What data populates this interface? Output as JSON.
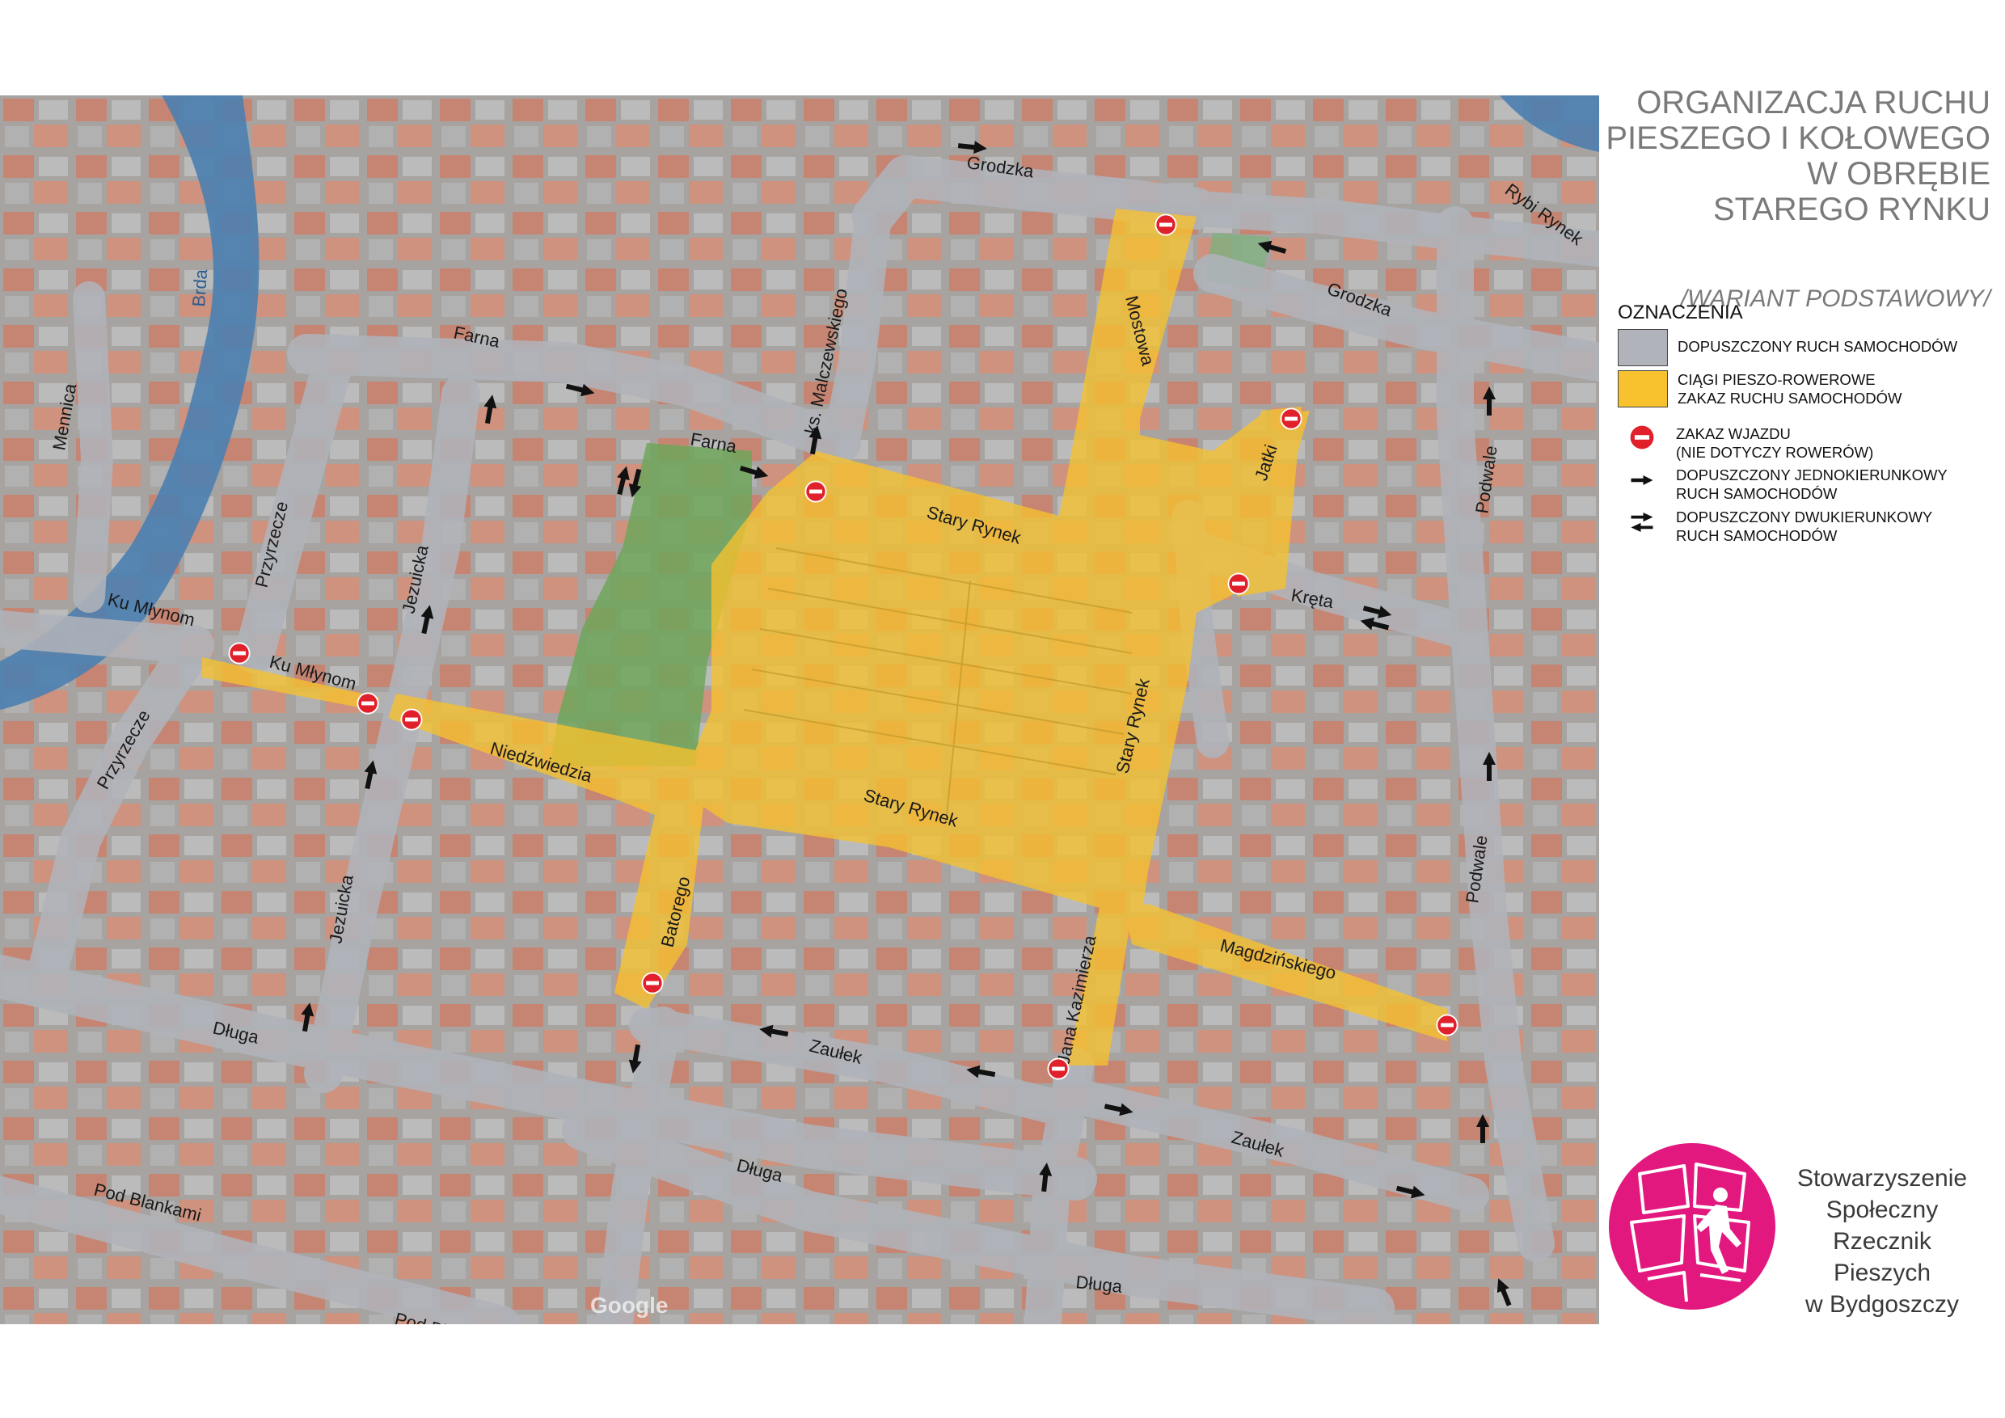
{
  "title_lines": [
    "ORGANIZACJA RUCHU",
    "PIESZEGO I KOŁOWEGO",
    "W OBRĘBIE",
    "STAREGO RYNKU"
  ],
  "subtitle": "/WARIANT PODSTAWOWY/",
  "legend": {
    "heading": "OZNACZENIA",
    "items": [
      {
        "symbol": "grey-swatch",
        "color": "#b0b3ba",
        "lines": [
          "DOPUSZCZONY RUCH SAMOCHODÓW"
        ]
      },
      {
        "symbol": "yellow-swatch",
        "color": "#f7c22e",
        "lines": [
          "CIĄGI PIESZO-ROWEROWE",
          "ZAKAZ RUCHU SAMOCHODÓW"
        ]
      },
      {
        "symbol": "no-entry-icon",
        "lines": [
          "ZAKAZ WJAZDU",
          "(NIE DOTYCZY ROWERÓW)"
        ]
      },
      {
        "symbol": "one-way-arrow-icon",
        "lines": [
          "DOPUSZCZONY JEDNOKIERUNKOWY",
          "RUCH SAMOCHODÓW"
        ]
      },
      {
        "symbol": "two-way-arrow-icon",
        "lines": [
          "DOPUSZCZONY DWUKIERUNKOWY",
          "RUCH SAMOCHODÓW"
        ]
      }
    ]
  },
  "organization": {
    "name_lines": [
      "Stowarzyszenie",
      "Społeczny",
      "Rzecznik Pieszych",
      "w Bydgoszczy"
    ],
    "logo_color": "#e3187f"
  },
  "map": {
    "river_label": "Brda",
    "watermark": "Google",
    "streets": {
      "grodzka_n": "Grodzka",
      "rybi_rynek": "Rybi Rynek",
      "grodzka_e": "Grodzka",
      "mostowa": "Mostowa",
      "malczewskiego": "ks. Malczewskiego",
      "farna_w": "Farna",
      "farna_e": "Farna",
      "mennica": "Mennica",
      "przyrzecze_n": "Przyrzecze",
      "jezuicka_n": "Jezuicka",
      "ku_mlynom_w": "Ku Młynom",
      "ku_mlynom_e": "Ku Młynom",
      "przyrzecze_s": "Przyrzecze",
      "niedzwiedzia": "Niedźwiedzia",
      "stary_rynek_n": "Stary Rynek",
      "jatki": "Jatki",
      "kreta": "Kręta",
      "podwale_n": "Podwale",
      "stary_rynek_e": "Stary Rynek",
      "stary_rynek_s": "Stary Rynek",
      "jezuicka_s": "Jezuicka",
      "batorego": "Batorego",
      "jana_kazimierza": "Jana Kazimierza",
      "magdzinskiego": "Magdzińskiego",
      "podwale_s": "Podwale",
      "dluga_w": "Długa",
      "zaulek_w": "Zaułek",
      "zaulek_e": "Zaułek",
      "dluga_m": "Długa",
      "pod_blankami_w": "Pod Blankami",
      "pod_blankami_e": "Pod Blankami",
      "dluga_e": "Długa"
    }
  }
}
